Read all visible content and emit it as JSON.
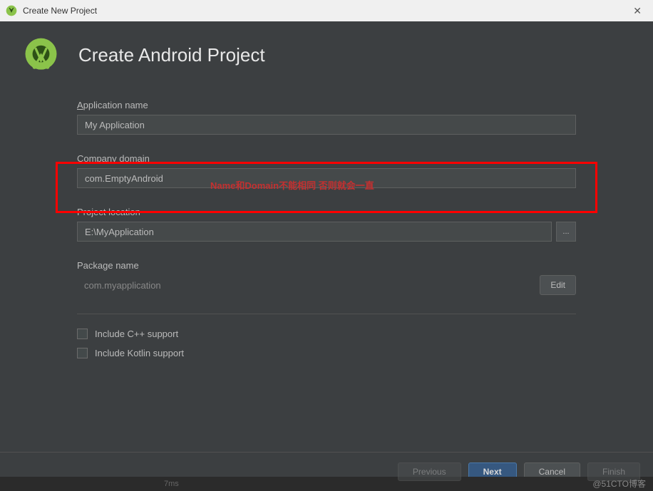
{
  "titlebar": {
    "title": "Create New Project"
  },
  "header": {
    "title": "Create Android Project"
  },
  "fields": {
    "app_name": {
      "label_prefix": "A",
      "label_rest": "pplication name",
      "value": "My Application"
    },
    "company_domain": {
      "label_prefix": "C",
      "label_rest": "ompany domain",
      "value": "com.EmptyAndroid"
    },
    "project_location": {
      "label": "Project location",
      "value": "E:\\MyApplication",
      "browse": "..."
    },
    "package_name": {
      "label": "Package name",
      "value": "com.myapplication",
      "edit": "Edit"
    }
  },
  "checkboxes": {
    "cpp": "Include C++ support",
    "kotlin": "Include Kotlin support"
  },
  "annotation": "Name和Domain不能相同 否则就会一直",
  "footer": {
    "previous": "Previous",
    "next": "Next",
    "cancel": "Cancel",
    "finish": "Finish"
  },
  "watermark": "@51CTO博客",
  "background": {
    "time": "7ms"
  }
}
